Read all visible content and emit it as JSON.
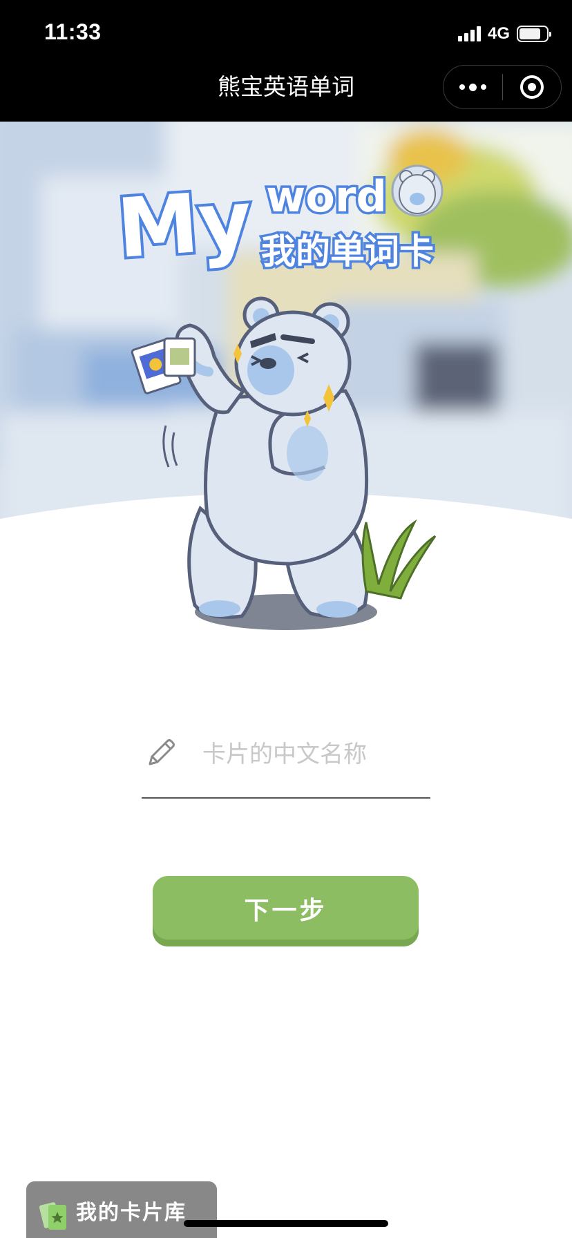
{
  "status_bar": {
    "time": "11:33",
    "network": "4G"
  },
  "nav": {
    "title": "熊宝英语单词",
    "more_icon": "more-dots-icon",
    "close_icon": "target-close-icon"
  },
  "hero": {
    "logo_word_1": "My",
    "logo_word_2": "word",
    "logo_subtitle": "我的单词卡",
    "bg_sky": "#cfdceb",
    "bg_ground": "#ffffff",
    "bear_color": "#dde6f1",
    "accent_blue": "#5b8de0"
  },
  "form": {
    "name_placeholder": "卡片的中文名称",
    "name_value": "",
    "pencil_icon": "pencil-icon"
  },
  "actions": {
    "next_label": "下一步",
    "next_color": "#8cbd62"
  },
  "footer": {
    "library_label": "我的卡片库",
    "library_icon": "card-stack-icon",
    "library_bg": "#888888"
  }
}
